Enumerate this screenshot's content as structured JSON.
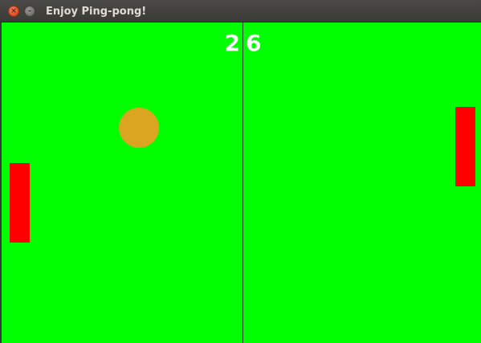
{
  "window": {
    "title": "Enjoy Ping-pong!",
    "close_glyph": "×",
    "minimize_glyph": "–"
  },
  "game": {
    "score_left": "2",
    "score_right": "6",
    "colors": {
      "field": "#00ff00",
      "paddle": "#ff0000",
      "ball": "#daa520",
      "net": "#1a3a1a",
      "score_text": "#ffffff"
    }
  }
}
